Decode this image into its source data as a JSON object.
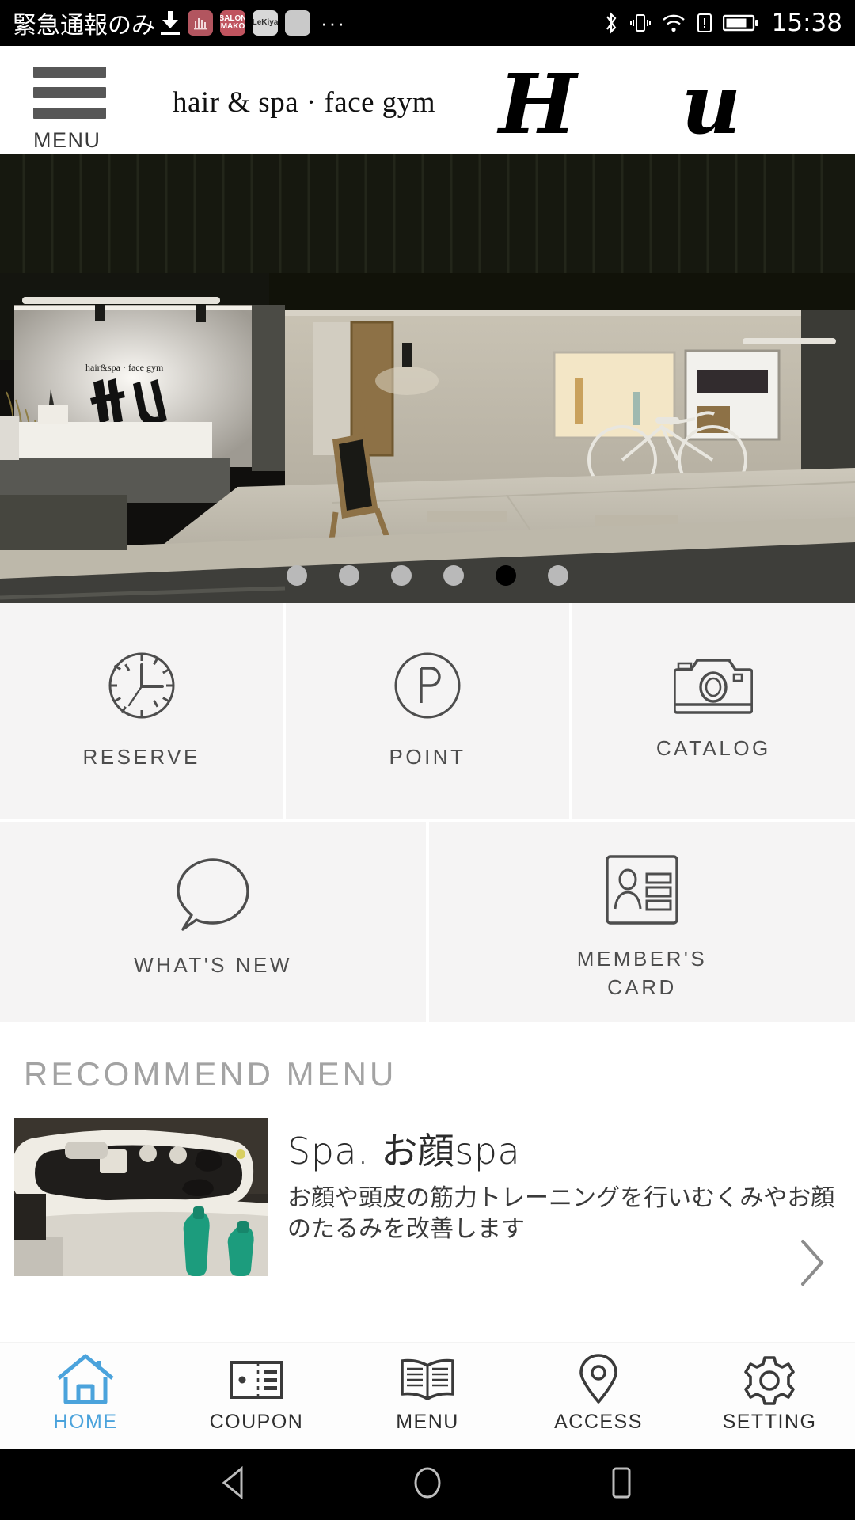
{
  "statusbar": {
    "carrier": "緊急通報のみ",
    "download_icon": "download-icon",
    "app_icons": [
      {
        "name": "app-icon-salon-1",
        "label": "",
        "color": "#b2555f"
      },
      {
        "name": "app-icon-salon-mako",
        "label": "SALON MAKO",
        "color": "#c0545f"
      },
      {
        "name": "app-icon-lekiya",
        "label": "LeKiya",
        "color": "#d8d8d8"
      },
      {
        "name": "app-icon-blank",
        "label": "",
        "color": "#c9c9c9"
      }
    ],
    "overflow": "···",
    "right_icons": [
      "bluetooth-icon",
      "vibrate-icon",
      "wifi-icon",
      "sim-alert-icon",
      "battery-icon"
    ],
    "time": "15:38"
  },
  "header": {
    "menu_label": "MENU",
    "tagline": "hair & spa · face gym",
    "logo": "H u"
  },
  "hero": {
    "alt": "salon-storefront-night-photo",
    "dots": [
      {
        "active": false
      },
      {
        "active": false
      },
      {
        "active": false
      },
      {
        "active": false
      },
      {
        "active": true
      },
      {
        "active": false
      }
    ]
  },
  "tiles": {
    "row1": [
      {
        "key": "reserve",
        "label": "RESERVE",
        "icon": "clock-icon"
      },
      {
        "key": "point",
        "label": "POINT",
        "icon": "point-p-icon"
      },
      {
        "key": "catalog",
        "label": "CATALOG",
        "icon": "camera-icon"
      }
    ],
    "row2": [
      {
        "key": "news",
        "label": "WHAT'S NEW",
        "icon": "speech-bubble-icon"
      },
      {
        "key": "member",
        "label": "MEMBER'S\nCARD",
        "icon": "member-card-icon"
      }
    ]
  },
  "recommend": {
    "section_title": "RECOMMEND MENU",
    "item": {
      "thumb_alt": "shampoo-bowl-photo",
      "name": "Spa. お顔spa",
      "description": "お顔や頭皮の筋力トレーニングを行いむくみやお顔のたるみを改善します",
      "chevron": "chevron-right-icon"
    }
  },
  "bottomnav": {
    "active_color": "#4ba3dc",
    "items": [
      {
        "key": "home",
        "label": "HOME",
        "icon": "home-icon",
        "active": true
      },
      {
        "key": "coupon",
        "label": "COUPON",
        "icon": "ticket-icon",
        "active": false
      },
      {
        "key": "menu",
        "label": "MENU",
        "icon": "book-icon",
        "active": false
      },
      {
        "key": "access",
        "label": "ACCESS",
        "icon": "map-pin-icon",
        "active": false
      },
      {
        "key": "setting",
        "label": "SETTING",
        "icon": "gear-icon",
        "active": false
      }
    ]
  },
  "androidnav": {
    "back": "back-triangle-icon",
    "home": "home-circle-icon",
    "recents": "recents-square-icon"
  }
}
